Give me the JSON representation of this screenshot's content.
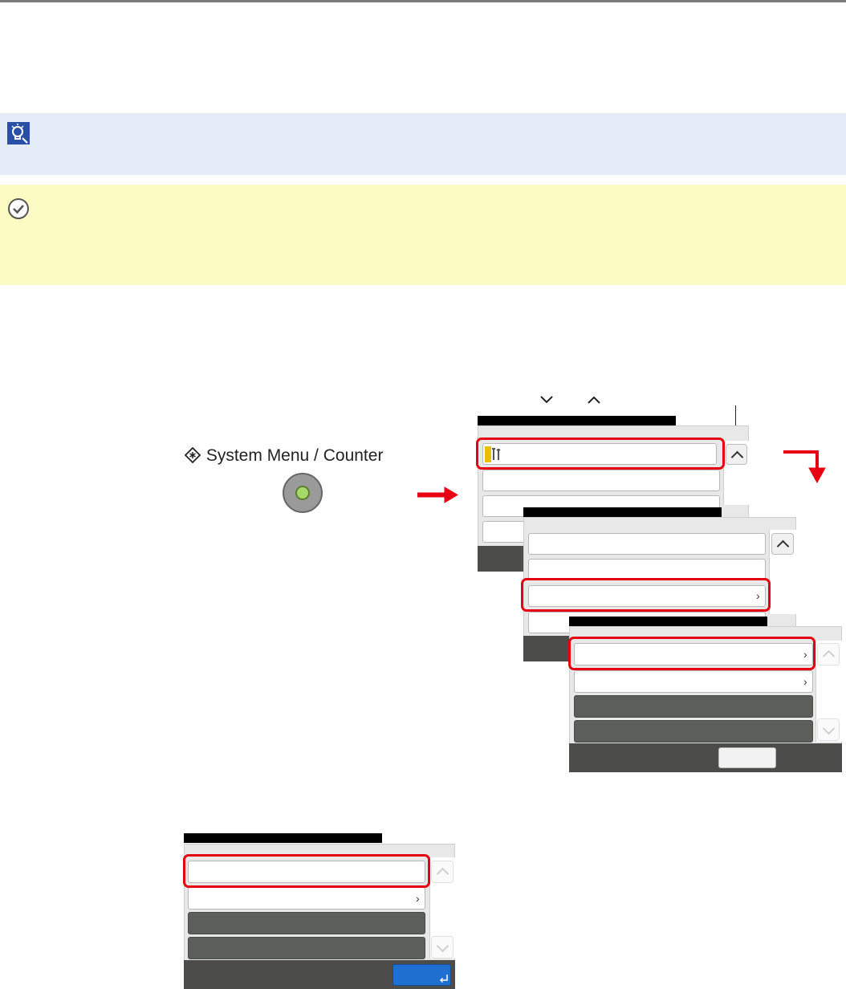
{
  "hardware": {
    "system_menu_label": "System Menu / Counter",
    "system_menu_icon": "diamond-asterisk-icon"
  },
  "icons": {
    "note": "lightbulb-tip-icon",
    "caution": "checkmark-circle-icon",
    "settings": "wrench-screwdriver-icon"
  },
  "colors": {
    "highlight": "#e60012",
    "note_bg": "#e4ecf8",
    "caution_bg": "#fdfbc4",
    "enter_button": "#1f6fd1"
  }
}
